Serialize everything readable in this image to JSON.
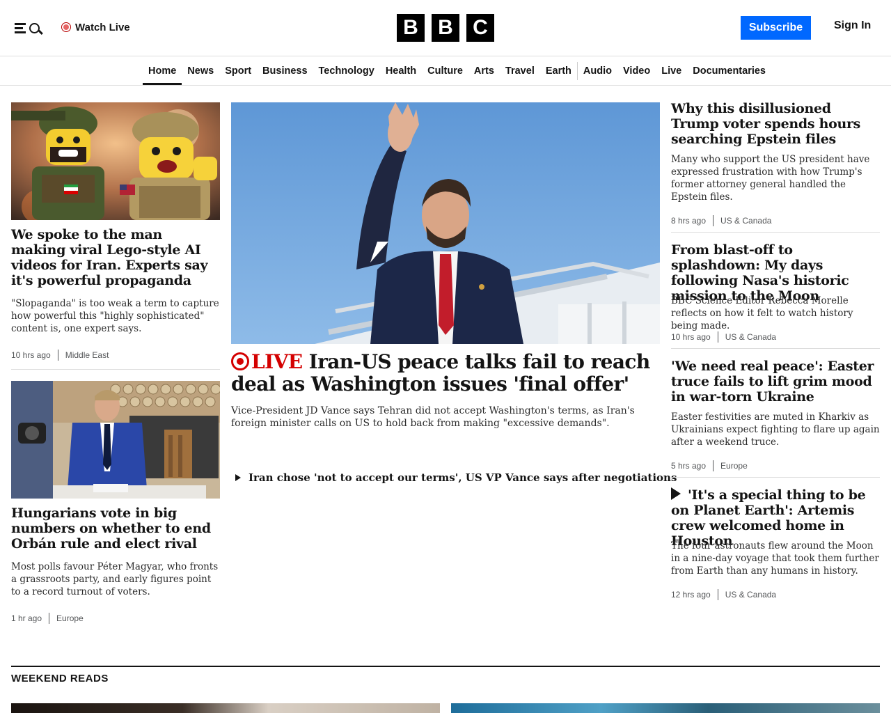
{
  "header": {
    "watch_live": "Watch Live",
    "logo_letters": [
      "B",
      "B",
      "C"
    ],
    "subscribe": "Subscribe",
    "sign_in": "Sign In"
  },
  "nav": {
    "items": [
      "Home",
      "News",
      "Sport",
      "Business",
      "Technology",
      "Health",
      "Culture",
      "Arts",
      "Travel",
      "Earth",
      "Audio",
      "Video",
      "Live",
      "Documentaries"
    ],
    "active": "Home"
  },
  "left": [
    {
      "headline": "We spoke to the man making viral Lego-style AI videos for Iran. Experts say it's powerful propaganda",
      "summary": "\"Slopaganda\" is too weak a term to capture how powerful this \"highly sophisticated\" content is, one expert says.",
      "time": "10 hrs ago",
      "tag": "Middle East"
    },
    {
      "headline": "Hungarians vote in big numbers on whether to end Orbán rule and elect rival",
      "summary": "Most polls favour Péter Magyar, who fronts a grassroots party, and early figures point to a record turnout of voters.",
      "time": "1 hr ago",
      "tag": "Europe"
    }
  ],
  "lead": {
    "live_label": "LIVE",
    "headline": "Iran-US peace talks fail to reach deal as Washington issues 'final offer'",
    "summary": "Vice-President JD Vance says Tehran did not accept Washington's terms, as Iran's foreign minister calls on US to hold back from making \"excessive demands\".",
    "related": "Iran chose 'not to accept our terms', US VP Vance says after negotiations"
  },
  "right": [
    {
      "headline": "Why this disillusioned Trump voter spends hours searching Epstein files",
      "summary": "Many who support the US president have expressed frustration with how Trump's former attorney general handled the Epstein files.",
      "time": "8 hrs ago",
      "tag": "US & Canada"
    },
    {
      "headline": "From blast-off to splashdown: My days following Nasa's historic mission to the Moon",
      "summary": "BBC Science Editor Rebecca Morelle reflects on how it felt to watch history being made.",
      "time": "10 hrs ago",
      "tag": "US & Canada"
    },
    {
      "headline": "'We need real peace': Easter truce fails to lift grim mood in war-torn Ukraine",
      "summary": "Easter festivities are muted in Kharkiv as Ukrainians expect fighting to flare up again after a weekend truce.",
      "time": "5 hrs ago",
      "tag": "Europe"
    },
    {
      "headline": "'It's a special thing to be on Planet Earth': Artemis crew welcomed home in Houston",
      "summary": "The four astronauts flew around the Moon in a nine-day voyage that took them further from Earth than any humans in history.",
      "time": "12 hrs ago",
      "tag": "US & Canada"
    }
  ],
  "section": {
    "title": "WEEKEND READS"
  }
}
